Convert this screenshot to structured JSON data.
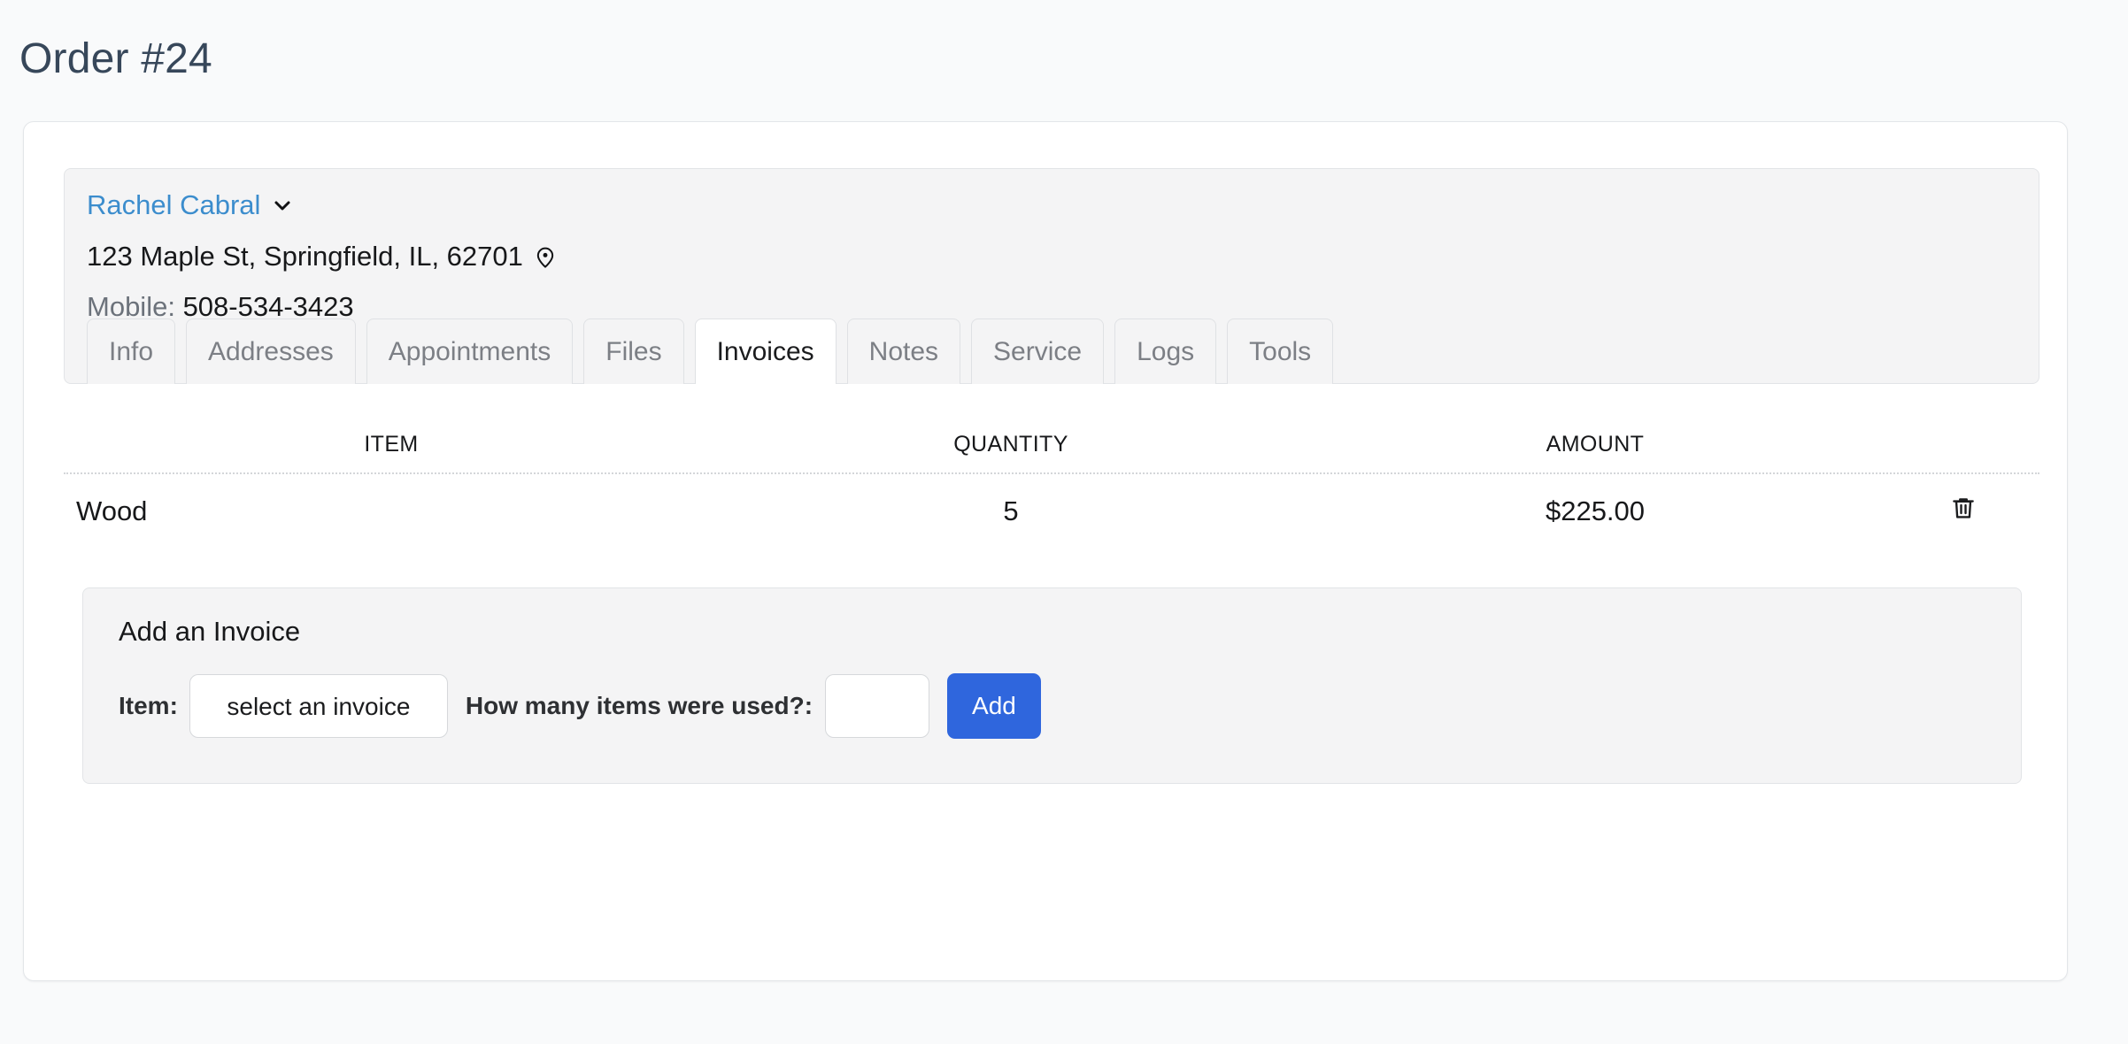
{
  "page": {
    "title": "Order #24"
  },
  "customer": {
    "name": "Rachel Cabral",
    "name_chevron_icon": "chevron-down-icon",
    "address": "123 Maple St, Springfield, IL, 62701",
    "address_pin_icon": "map-pin-icon",
    "mobile_label": "Mobile:",
    "mobile_value": "508-534-3423"
  },
  "tabs": [
    {
      "label": "Info",
      "active": false
    },
    {
      "label": "Addresses",
      "active": false
    },
    {
      "label": "Appointments",
      "active": false
    },
    {
      "label": "Files",
      "active": false
    },
    {
      "label": "Invoices",
      "active": true
    },
    {
      "label": "Notes",
      "active": false
    },
    {
      "label": "Service",
      "active": false
    },
    {
      "label": "Logs",
      "active": false
    },
    {
      "label": "Tools",
      "active": false
    }
  ],
  "invoices_table": {
    "columns": [
      "ITEM",
      "QUANTITY",
      "AMOUNT",
      ""
    ],
    "rows": [
      {
        "item": "Wood",
        "quantity": "5",
        "amount": "$225.00",
        "delete_icon": "trash-icon"
      }
    ]
  },
  "add_invoice": {
    "heading": "Add an Invoice",
    "item_label": "Item:",
    "item_select_value": "select an invoice",
    "item_select_options": [
      "select an invoice"
    ],
    "quantity_label": "How many items were used?:",
    "quantity_value": "",
    "quantity_placeholder": "",
    "add_button_label": "Add"
  },
  "colors": {
    "page_background": "#f9fafb",
    "card_background": "#ffffff",
    "panel_background": "#f4f4f5",
    "title_text": "#37475a",
    "link_blue": "#3c8dcd",
    "primary_button": "#2f66dd",
    "muted_text": "#7c7f85",
    "border": "#e2e4e7"
  }
}
